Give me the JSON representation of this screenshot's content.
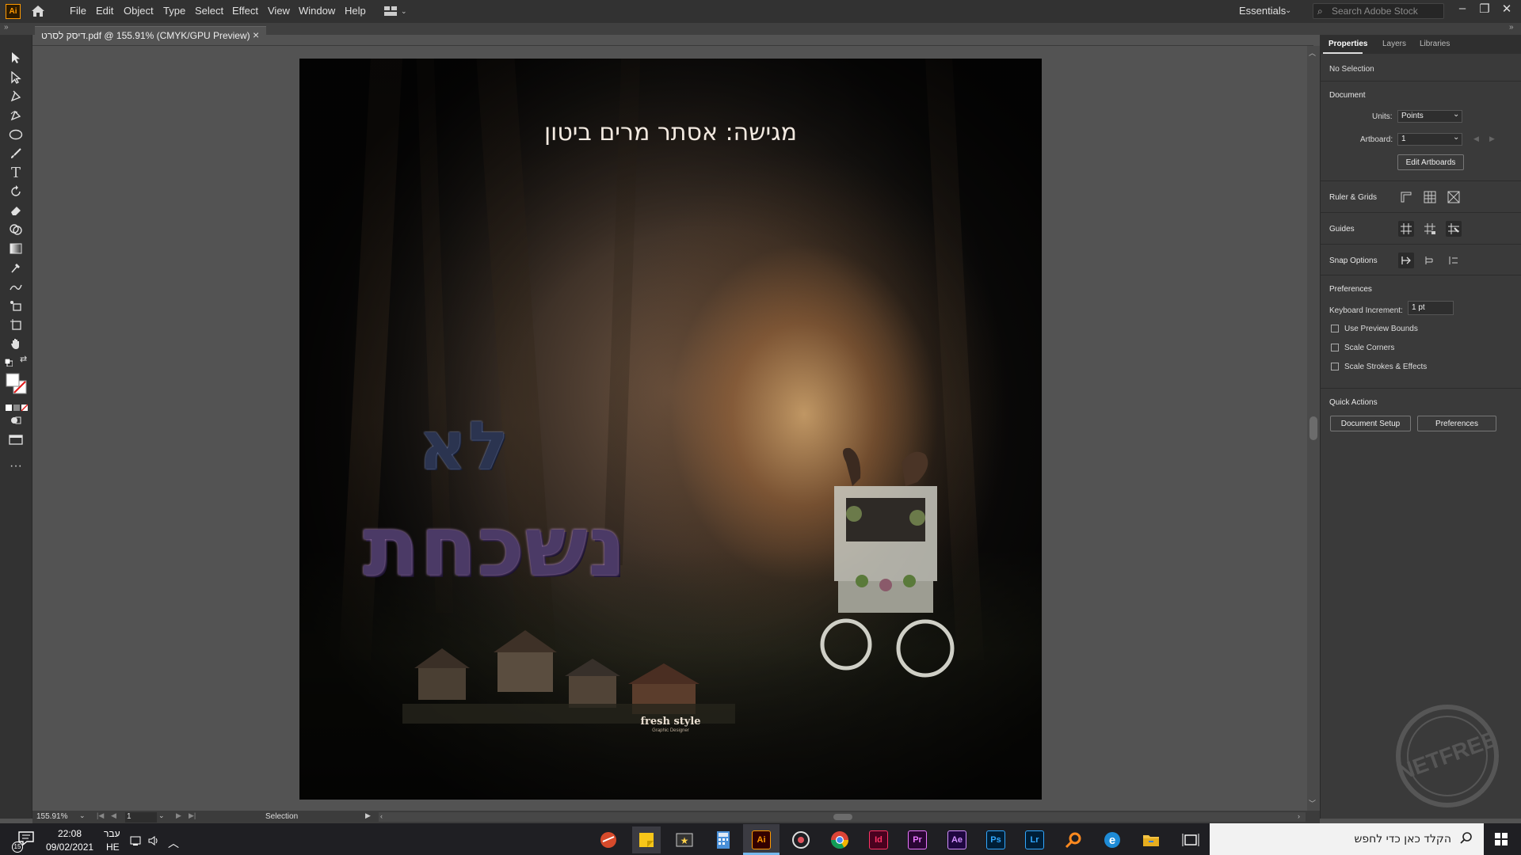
{
  "menubar": {
    "app_icon": "Ai",
    "items": [
      "File",
      "Edit",
      "Object",
      "Type",
      "Select",
      "Effect",
      "View",
      "Window",
      "Help"
    ],
    "workspace": "Essentials",
    "stock_search_placeholder": "Search Adobe Stock",
    "window_controls": [
      "minimize-icon",
      "restore-icon",
      "close-icon"
    ]
  },
  "document": {
    "tab_title": "דיסק לסרט.pdf @ 155.91% (CMYK/GPU Preview)",
    "tab_close": "×"
  },
  "artwork": {
    "title": "מגישה: אסתר מרים ביטון",
    "word1": "לא",
    "word2": "נשכחת",
    "logo_name": "fresh style",
    "logo_sub": "Graphic Designer"
  },
  "statusbar": {
    "zoom": "155.91%",
    "artboard": "1",
    "tool": "Selection"
  },
  "properties": {
    "tabs": [
      "Properties",
      "Layers",
      "Libraries"
    ],
    "active_tab": "Properties",
    "selection_state": "No Selection",
    "document_section": "Document",
    "units_label": "Units:",
    "units_value": "Points",
    "artboard_label": "Artboard:",
    "artboard_value": "1",
    "edit_artboards": "Edit Artboards",
    "ruler_grids": "Ruler & Grids",
    "guides": "Guides",
    "snap_options": "Snap Options",
    "preferences_section": "Preferences",
    "keyboard_increment_label": "Keyboard Increment:",
    "keyboard_increment_value": "1 pt",
    "checkboxes": [
      {
        "label": "Use Preview Bounds",
        "checked": false
      },
      {
        "label": "Scale Corners",
        "checked": false
      },
      {
        "label": "Scale Strokes & Effects",
        "checked": false
      }
    ],
    "quick_actions": "Quick Actions",
    "document_setup": "Document Setup",
    "preferences_button": "Preferences"
  },
  "taskbar": {
    "notification_count": "15",
    "time": "22:08",
    "date": "09/02/2021",
    "lang_top": "עבר",
    "lang_bottom": "HE",
    "search_text": "הקלד כאן כדי לחפש",
    "apps": [
      {
        "name": "Id",
        "color": "#ff3366",
        "bg": "#49021f"
      },
      {
        "name": "Pr",
        "color": "#ea77ff",
        "bg": "#2a0634"
      },
      {
        "name": "Ae",
        "color": "#d291ff",
        "bg": "#1f0740"
      },
      {
        "name": "Ps",
        "color": "#31a8ff",
        "bg": "#001e36"
      },
      {
        "name": "Lr",
        "color": "#31a8ff",
        "bg": "#001e36"
      },
      {
        "name": "Ai",
        "color": "#ff9a00",
        "bg": "#330000"
      }
    ]
  },
  "colors": {
    "accent": "#ff9a00",
    "panel": "#3a3a3a",
    "canvas": "#535353"
  }
}
